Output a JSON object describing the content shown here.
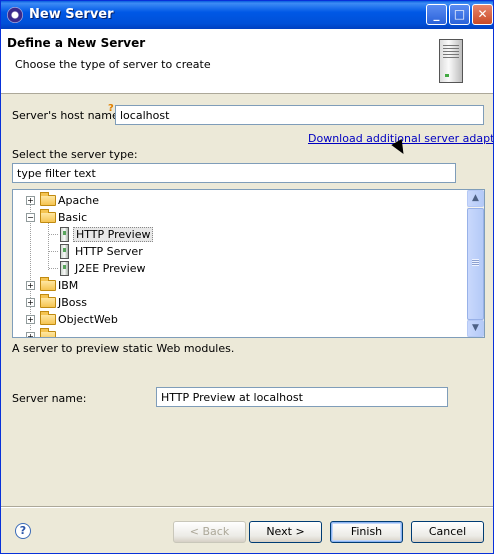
{
  "window": {
    "title": "New Server"
  },
  "header": {
    "title": "Define a New Server",
    "description": "Choose the type of server to create"
  },
  "host": {
    "label": "Server's host name:",
    "value": "localhost"
  },
  "download_link": "Download additional server adapters",
  "server_type": {
    "label": "Select the server type:",
    "filter_placeholder": "type filter text"
  },
  "tree": {
    "items": [
      {
        "label": "Apache",
        "kind": "folder",
        "expanded": false,
        "level": 0
      },
      {
        "label": "Basic",
        "kind": "folder",
        "expanded": true,
        "level": 0
      },
      {
        "label": "HTTP Preview",
        "kind": "server",
        "level": 1,
        "selected": true
      },
      {
        "label": "HTTP Server",
        "kind": "server",
        "level": 1
      },
      {
        "label": "J2EE Preview",
        "kind": "server",
        "level": 1
      },
      {
        "label": "IBM",
        "kind": "folder",
        "expanded": false,
        "level": 0
      },
      {
        "label": "JBoss",
        "kind": "folder",
        "expanded": false,
        "level": 0
      },
      {
        "label": "ObjectWeb",
        "kind": "folder",
        "expanded": false,
        "level": 0
      }
    ]
  },
  "description": "A server to preview static Web modules.",
  "server_name": {
    "label": "Server name:",
    "value": "HTTP Preview at localhost"
  },
  "buttons": {
    "back": "< Back",
    "next": "Next >",
    "finish": "Finish",
    "cancel": "Cancel"
  },
  "icons": {
    "help": "help-icon",
    "server": "server-icon",
    "folder": "folder-icon"
  }
}
